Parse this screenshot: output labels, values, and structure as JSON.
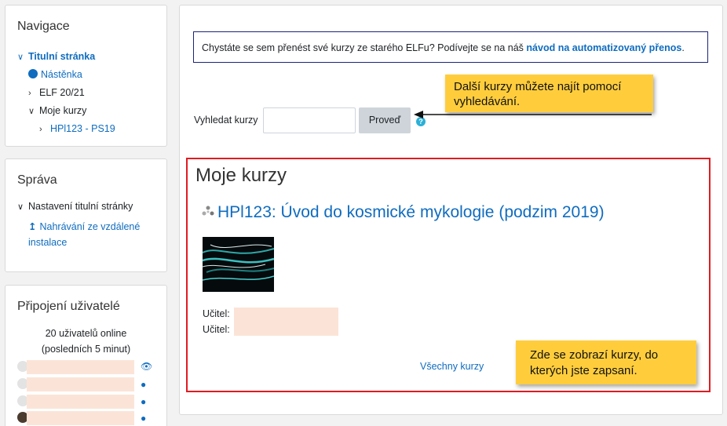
{
  "navigation": {
    "title": "Navigace",
    "items": [
      {
        "label": "Titulní stránka",
        "icon": "chevron-down-icon"
      },
      {
        "label": "Nástěnka",
        "icon": "dashboard-icon"
      },
      {
        "label": "ELF 20/21",
        "icon": "chevron-right-icon"
      },
      {
        "label": "Moje kurzy",
        "icon": "chevron-down-icon"
      },
      {
        "label": "HPl123 - PS19",
        "icon": "chevron-right-icon"
      }
    ]
  },
  "admin": {
    "title": "Správa",
    "item1": "Nastavení titulní stránky",
    "item2_line1": "Nahrávání ze vzdálené",
    "item2_line2": "instalace"
  },
  "online": {
    "title": "Připojení uživatelé",
    "line1": "20 uživatelů online",
    "line2": "(posledních 5 minut)"
  },
  "notice": {
    "text": "Chystáte se sem přenést své kurzy ze starého ELFu? Podívejte se na náš ",
    "link": "návod na automatizovaný přenos",
    "end": "."
  },
  "search": {
    "label": "Vyhledat kurzy",
    "button": "Proveď",
    "placeholder": "",
    "help": "?"
  },
  "tooltips": {
    "search_line1": "Další kurzy můžete najít pomocí",
    "search_line2": "vyhledávání.",
    "courses_line1": "Zde se zobrazí kurzy, do",
    "courses_line2": "kterých jste zapsaní."
  },
  "my_courses": {
    "title": "Moje kurzy",
    "course_title": "HPl123: Úvod do kosmické mykologie (podzim 2019)",
    "teacher_label_1": "Učitel:",
    "teacher_label_2": "Učitel:",
    "all_courses": "Všechny kurzy"
  },
  "colors": {
    "link": "#0f6cbf",
    "highlight_box": "#e11b22",
    "sticky_note": "#ffcd3c",
    "notice_border": "#1a237e"
  }
}
